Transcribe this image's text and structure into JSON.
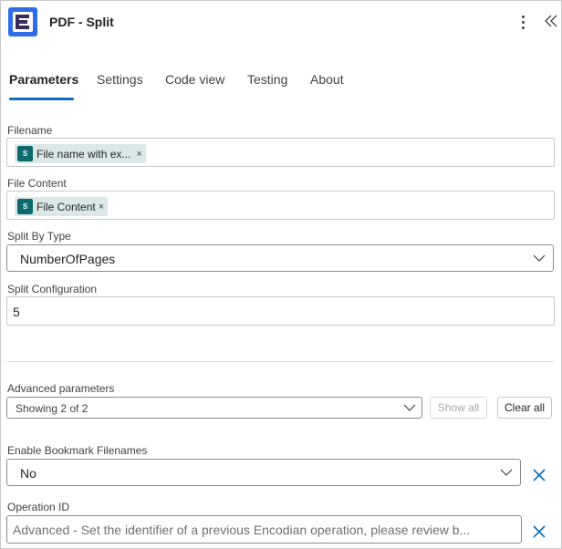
{
  "header": {
    "title": "PDF - Split",
    "icons": {
      "app": "encodian-logo-icon",
      "menu": "more-vertical-icon",
      "collapse": "double-chevron-left-icon"
    },
    "brand_color": "#2d6ee8"
  },
  "tabs": [
    {
      "label": "Parameters",
      "active": true
    },
    {
      "label": "Settings",
      "active": false
    },
    {
      "label": "Code view",
      "active": false
    },
    {
      "label": "Testing",
      "active": false
    },
    {
      "label": "About",
      "active": false
    }
  ],
  "fields": {
    "filename": {
      "label": "Filename",
      "token": {
        "icon_text": "S",
        "text": "File name with ex...",
        "remove": "×"
      }
    },
    "file_content": {
      "label": "File Content",
      "token": {
        "icon_text": "S",
        "text": "File Content",
        "remove": "×"
      }
    },
    "split_by_type": {
      "label": "Split By Type",
      "value": "NumberOfPages"
    },
    "split_configuration": {
      "label": "Split Configuration",
      "value": "5"
    }
  },
  "advanced": {
    "label": "Advanced parameters",
    "selected": "Showing 2 of 2",
    "show_all": "Show all",
    "clear_all": "Clear all"
  },
  "bookmark": {
    "label": "Enable Bookmark Filenames",
    "value": "No"
  },
  "operation_id": {
    "label": "Operation ID",
    "placeholder": "Advanced - Set the identifier of a previous Encodian operation, please review b..."
  },
  "colors": {
    "accent": "#0f6cbd",
    "token_bg": "#dbe8e8",
    "token_icon": "#0b6a6a"
  }
}
